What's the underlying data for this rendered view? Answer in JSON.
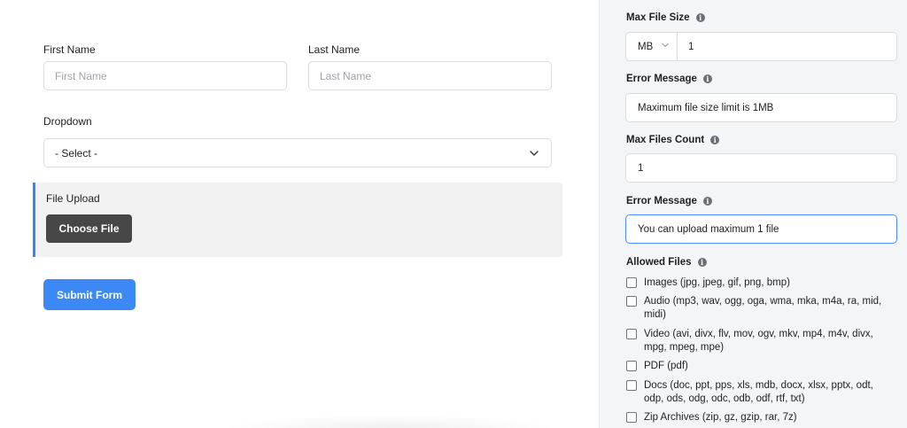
{
  "form": {
    "first_name_label": "First Name",
    "first_name_placeholder": "First Name",
    "last_name_label": "Last Name",
    "last_name_placeholder": "Last Name",
    "dropdown_label": "Dropdown",
    "dropdown_value": "- Select -",
    "file_upload_label": "File Upload",
    "choose_file_label": "Choose File",
    "submit_label": "Submit Form"
  },
  "settings": {
    "max_file_size_label": "Max File Size",
    "size_unit": "MB",
    "size_value": "1",
    "error_message_label_1": "Error Message",
    "error_message_1": "Maximum file size limit is 1MB",
    "max_files_count_label": "Max Files Count",
    "max_files_count": "1",
    "error_message_label_2": "Error Message",
    "error_message_2": "You can upload maximum 1 file",
    "allowed_files_label": "Allowed Files",
    "allowed_files": [
      "Images (jpg, jpeg, gif, png, bmp)",
      "Audio (mp3, wav, ogg, oga, wma, mka, m4a, ra, mid, midi)",
      "Video (avi, divx, flv, mov, ogv, mkv, mp4, m4v, divx, mpg, mpeg, mpe)",
      "PDF (pdf)",
      "Docs (doc, ppt, pps, xls, mdb, docx, xlsx, pptx, odt, odp, ods, odg, odc, odb, odf, rtf, txt)",
      "Zip Archives (zip, gz, gzip, rar, 7z)"
    ]
  },
  "icons": {
    "info": "info-icon",
    "chevron": "chevron-down-icon"
  },
  "colors": {
    "accent": "#3c88f5",
    "upload_border": "#3b82f6",
    "choose_button": "#474747",
    "panel_bg": "#f4f5f6"
  }
}
